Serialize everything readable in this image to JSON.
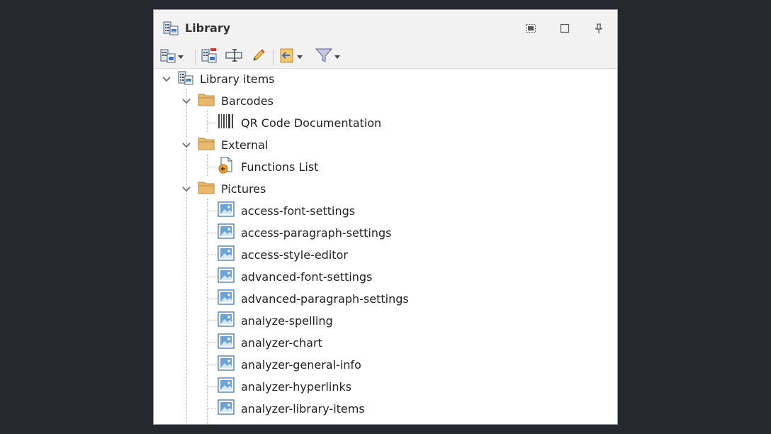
{
  "panel": {
    "title": "Library",
    "window_buttons": [
      "float-icon",
      "maximize-icon",
      "pin-icon"
    ]
  },
  "toolbar": {
    "buttons": [
      "library-dropdown-icon",
      "new-library-item-icon",
      "rename-icon",
      "edit-icon",
      "insert-dropdown-icon",
      "filter-dropdown-icon"
    ]
  },
  "tree": {
    "root": {
      "label": "Library items",
      "expanded": true
    },
    "folders": [
      {
        "label": "Barcodes",
        "expanded": true,
        "items": [
          {
            "label": "QR Code Documentation",
            "icon": "barcode-icon"
          }
        ]
      },
      {
        "label": "External",
        "expanded": true,
        "items": [
          {
            "label": "Functions List",
            "icon": "function-file-icon"
          }
        ]
      },
      {
        "label": "Pictures",
        "expanded": true,
        "items": [
          {
            "label": "access-font-settings",
            "icon": "picture-icon"
          },
          {
            "label": "access-paragraph-settings",
            "icon": "picture-icon"
          },
          {
            "label": "access-style-editor",
            "icon": "picture-icon"
          },
          {
            "label": "advanced-font-settings",
            "icon": "picture-icon"
          },
          {
            "label": "advanced-paragraph-settings",
            "icon": "picture-icon"
          },
          {
            "label": "analyze-spelling",
            "icon": "picture-icon"
          },
          {
            "label": "analyzer-chart",
            "icon": "picture-icon"
          },
          {
            "label": "analyzer-general-info",
            "icon": "picture-icon"
          },
          {
            "label": "analyzer-hyperlinks",
            "icon": "picture-icon"
          },
          {
            "label": "analyzer-library-items",
            "icon": "picture-icon"
          }
        ]
      }
    ]
  },
  "colors": {
    "folder": "#e8b86d",
    "folder_border": "#b98a3e",
    "picture_frame": "#3f78b8",
    "accent_orange": "#f0a030"
  }
}
